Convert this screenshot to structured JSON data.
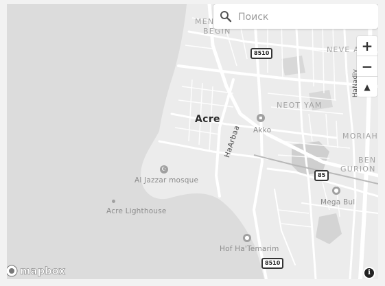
{
  "search": {
    "placeholder": "Поиск"
  },
  "controls": {
    "zoom_in": "+",
    "zoom_out": "−",
    "compass": "▲"
  },
  "attribution": {
    "logo_text": "mapbox",
    "info_label": "i"
  },
  "labels": {
    "men_begin_1": "MENA",
    "men_begin_2": "BEGIN",
    "neve_av": "NEVE AV",
    "neot_yam": "NEOT YAM",
    "moriah": "MORIAH",
    "ben": "BEN",
    "gurion": "GURION",
    "acre": "Acre",
    "akko": "Akko",
    "haarbaa": "HaArbaa",
    "hanadiv": "HaNadiv",
    "al_jazzar": "Al Jazzar mosque",
    "acre_lighthouse": "Acre Lighthouse",
    "hof_hatemarim": "Hof Ha'Temarim",
    "mega_bul": "Mega Bul"
  },
  "shields": {
    "top": "8510",
    "mid": "85",
    "bottom": "8510"
  },
  "colors": {
    "water": "#dcdcdc",
    "land": "#ececec",
    "road": "#ffffff",
    "park": "#cfcfcf"
  }
}
